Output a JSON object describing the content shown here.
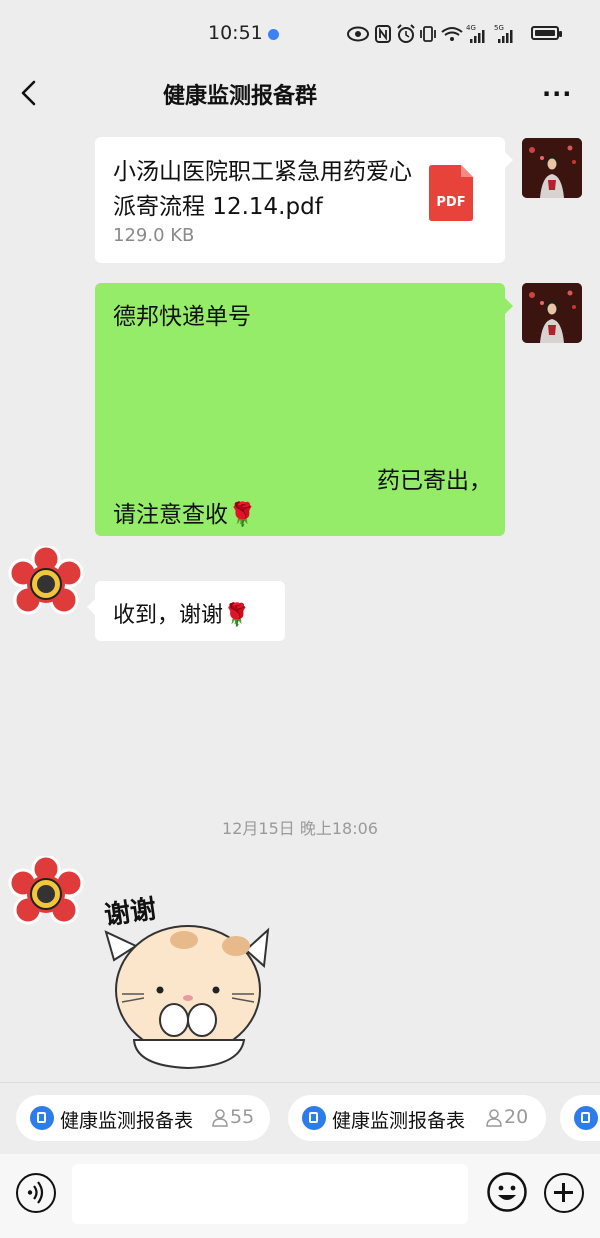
{
  "status_bar": {
    "time": "10:51",
    "icons": [
      "eye-icon",
      "nfc-icon",
      "alarm-icon",
      "vibrate-icon",
      "wifi-icon",
      "signal-4g-icon",
      "signal-5g-icon",
      "battery-icon"
    ],
    "network_1": "4G",
    "network_2": "5G"
  },
  "header": {
    "title": "健康监测报备群",
    "back_icon": "chevron-left-icon",
    "more_icon": "more-dots-icon",
    "more_glyph": "···"
  },
  "messages": [
    {
      "type": "file",
      "side": "right",
      "file_name": "小汤山医院职工紧急用药爱心派寄流程 12.14.pdf",
      "file_size": "129.0 KB",
      "file_icon": "pdf-icon",
      "file_icon_label": "PDF"
    },
    {
      "type": "text",
      "side": "right",
      "line1": "德邦快递单号",
      "line2": "药已寄出，",
      "line3": "请注意查收🌹"
    },
    {
      "type": "text",
      "side": "left",
      "text": "收到，谢谢🌹"
    },
    {
      "type": "timestamp",
      "text": "12月15日 晚上18:06"
    },
    {
      "type": "sticker",
      "side": "left",
      "sticker": "cat-thanks-sticker",
      "caption": "谢谢"
    }
  ],
  "mini_programs": [
    {
      "label": "健康监测报备表",
      "count": "55"
    },
    {
      "label": "健康监测报备表",
      "count": "20"
    }
  ],
  "input_bar": {
    "voice_icon": "voice-icon",
    "emoji_icon": "emoji-icon",
    "plus_icon": "plus-icon",
    "placeholder": ""
  },
  "colors": {
    "background": "#ededed",
    "green_bubble": "#95ec69",
    "pdf_red": "#e8433b",
    "chip_blue": "#2b7de9"
  }
}
